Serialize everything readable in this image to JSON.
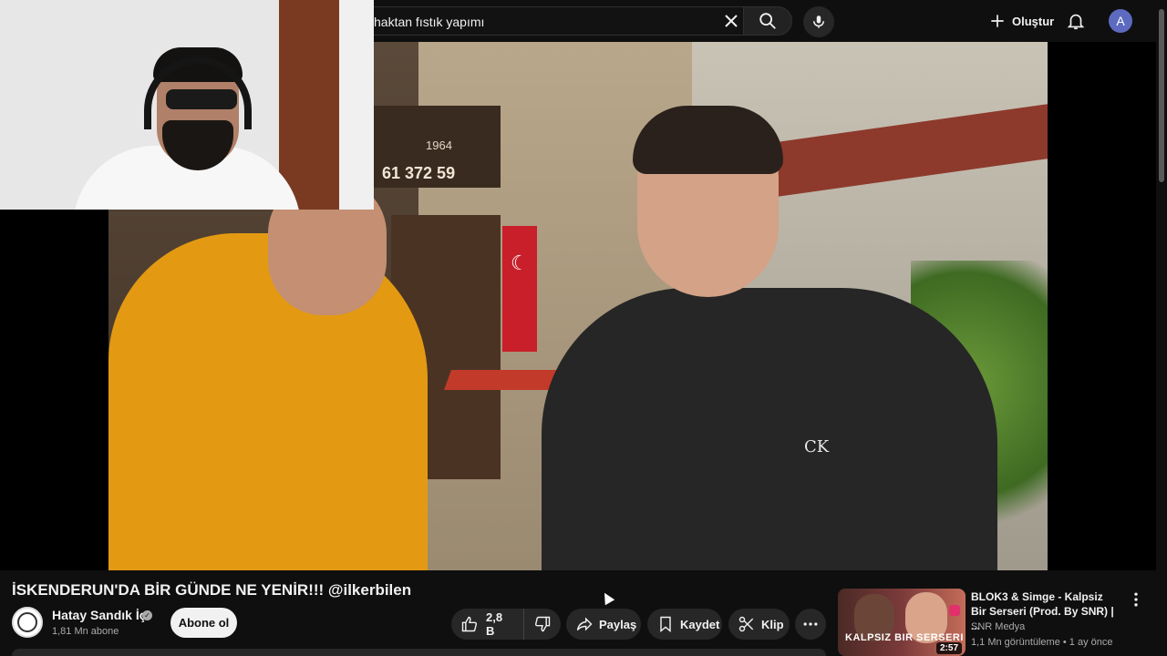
{
  "search": {
    "query": "haktan fıstık yapımı"
  },
  "header": {
    "create_label": "Oluştur",
    "avatar_letter": "A"
  },
  "video_frame": {
    "sign_year": "1964",
    "sign_phone": "61 372 59",
    "logo_text": "CK"
  },
  "video": {
    "title": "İSKENDERUN'DA BİR GÜNDE NE YENİR!!! @ilkerbilen",
    "channel_name": "Hatay Sandık İçi",
    "subscriber_count": "1,81 Mn abone",
    "subscribe_label": "Abone ol",
    "like_count": "2,8 B",
    "share_label": "Paylaş",
    "save_label": "Kaydet",
    "clip_label": "Klip"
  },
  "recommended": {
    "title": "BLOK3 & Simge - Kalpsiz Bir Serseri (Prod. By SNR) | ...",
    "channel": "SNR Medya",
    "meta": "1,1 Mn görüntüleme • 1 ay önce",
    "duration": "2:57",
    "thumb_text": "KALPSIZ BIR SERSERI"
  },
  "icons": {
    "clear": "close-icon",
    "search": "search-icon",
    "mic": "mic-icon",
    "create": "plus-icon",
    "bell": "bell-icon",
    "like": "thumbs-up-icon",
    "dislike": "thumbs-down-icon",
    "share": "share-icon",
    "save": "bookmark-icon",
    "clip": "scissors-icon",
    "more": "more-horizontal-icon"
  }
}
